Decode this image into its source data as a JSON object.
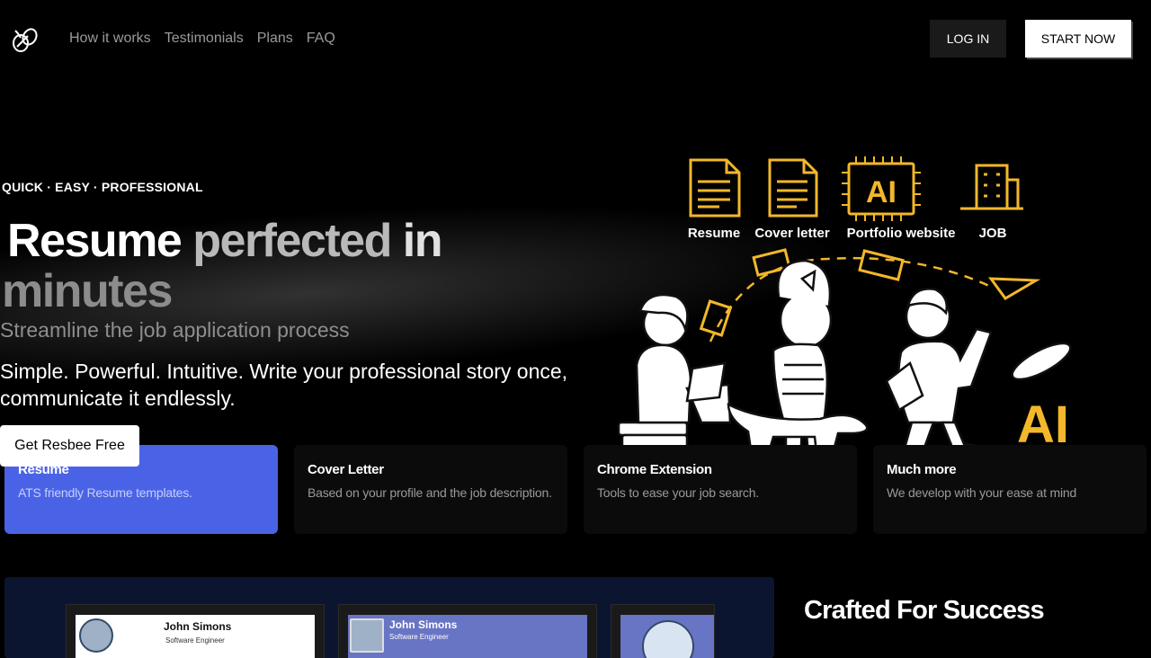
{
  "nav": {
    "links": [
      "How it works",
      "Testimonials",
      "Plans",
      "FAQ"
    ],
    "login_label": "LOG IN",
    "start_label": "START NOW"
  },
  "hero": {
    "tagline": "QUICK · EASY · PROFESSIONAL",
    "headline": {
      "word1": "Resume",
      "word2": "perfected",
      "word3": "in",
      "word4": "minutes"
    },
    "subhead": "Streamline the job application process",
    "lede": "Simple. Powerful. Intuitive. Write your professional story once, communicate it endlessly.",
    "cta_label": "Get Resbee Free"
  },
  "illustration": {
    "labels": [
      "Resume",
      "Cover letter",
      "Portfolio website",
      "JOB"
    ],
    "ai_badge": "AI",
    "ai_icon_text": "AI",
    "accent": "#f2b72a"
  },
  "features": [
    {
      "title": "Resume",
      "desc": "ATS friendly Resume templates."
    },
    {
      "title": "Cover Letter",
      "desc": "Based on your profile and the job description."
    },
    {
      "title": "Chrome Extension",
      "desc": "Tools to ease your job search."
    },
    {
      "title": "Much more",
      "desc": "We develop with your ease at mind"
    }
  ],
  "preview": {
    "templates": [
      {
        "name": "John Simons",
        "role": "Software Engineer"
      },
      {
        "name": "John Simons",
        "role": "Software Engineer"
      }
    ],
    "heading": "Crafted For Success"
  },
  "colors": {
    "accent_blue": "#4a63e6",
    "accent_yellow": "#f2b72a"
  }
}
